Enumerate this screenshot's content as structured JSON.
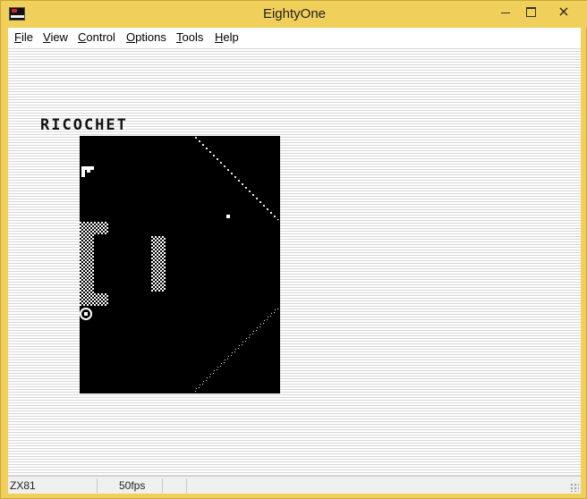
{
  "window": {
    "title": "EightyOne",
    "controls": {
      "minimize": "minimize",
      "maximize": "maximize",
      "close": "×"
    }
  },
  "menu": {
    "items": [
      {
        "label": "File",
        "key": "F",
        "rest": "ile"
      },
      {
        "label": "View",
        "key": "V",
        "rest": "iew"
      },
      {
        "label": "Control",
        "key": "C",
        "rest": "ontrol"
      },
      {
        "label": "Options",
        "key": "O",
        "rest": "ptions"
      },
      {
        "label": "Tools",
        "key": "T",
        "rest": "ools"
      },
      {
        "label": "Help",
        "key": "H",
        "rest": "elp"
      }
    ]
  },
  "game": {
    "title": "RICOCHET"
  },
  "status": {
    "machine": "ZX81",
    "fps": "50fps"
  },
  "colors": {
    "titlebar": "#f1cf5b",
    "screen": "#000000",
    "pixels": "#ffffff"
  }
}
